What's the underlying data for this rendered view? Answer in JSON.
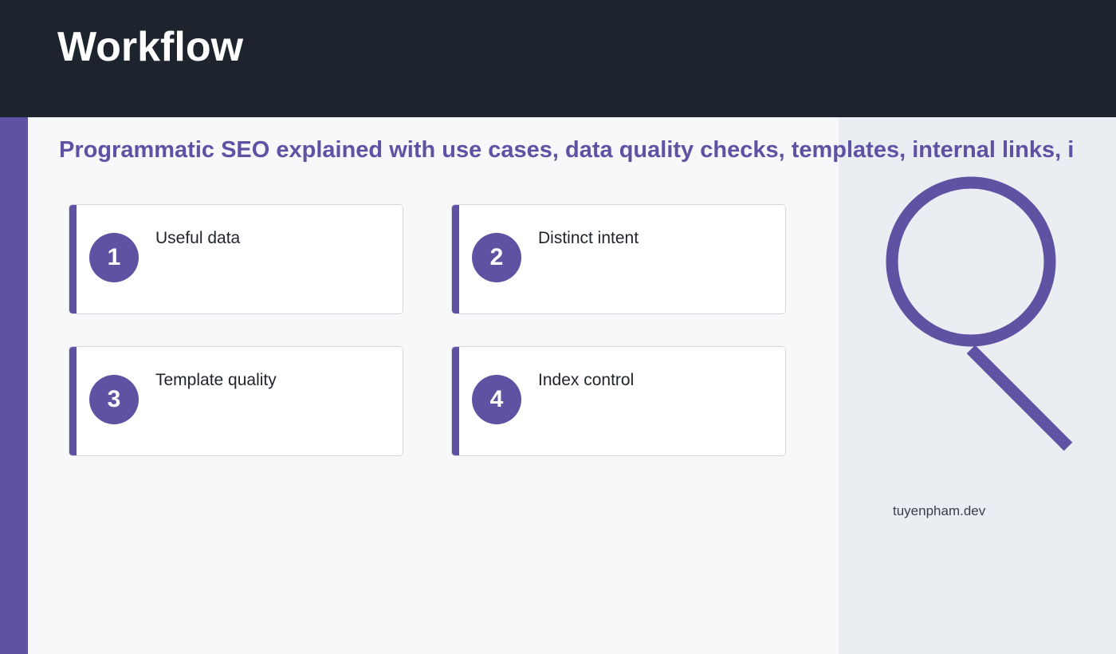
{
  "header": {
    "title": "Workflow"
  },
  "subtitle": "Programmatic SEO explained with use cases, data quality checks, templates, internal links, i",
  "cards": [
    {
      "number": "1",
      "label": "Useful data"
    },
    {
      "number": "2",
      "label": "Distinct intent"
    },
    {
      "number": "3",
      "label": "Template quality"
    },
    {
      "number": "4",
      "label": "Index control"
    }
  ],
  "illustration": {
    "icon": "magnifier-icon"
  },
  "footer": {
    "domain": "tuyenpham.dev"
  },
  "colors": {
    "header_bg": "#1e242e",
    "accent": "#6052a3",
    "page_bg": "#f7f8fa",
    "panel_bg": "#eaedf1",
    "card_border": "#d3d8e0"
  }
}
